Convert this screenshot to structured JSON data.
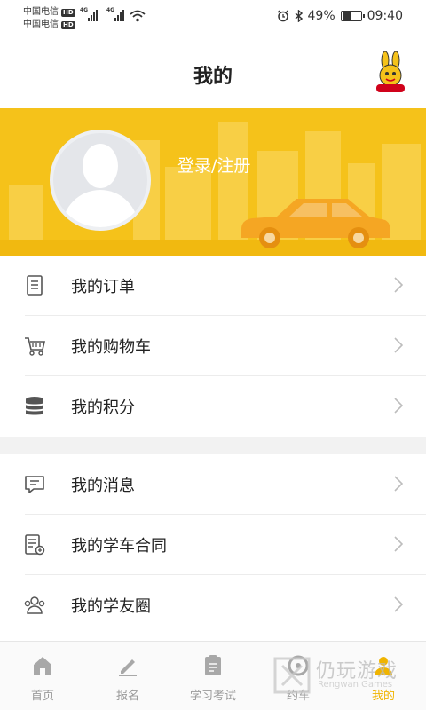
{
  "status_bar": {
    "carrier_1": "中国电信",
    "carrier_2": "中国电信",
    "hd": "HD",
    "network": "4G",
    "battery": "49%",
    "time": "09:40"
  },
  "header": {
    "title": "我的"
  },
  "profile": {
    "login_label": "登录/注册"
  },
  "menu_group_1": [
    {
      "label": "我的订单",
      "icon": "order-icon"
    },
    {
      "label": "我的购物车",
      "icon": "cart-icon"
    },
    {
      "label": "我的积分",
      "icon": "points-icon"
    }
  ],
  "menu_group_2": [
    {
      "label": "我的消息",
      "icon": "message-icon"
    },
    {
      "label": "我的学车合同",
      "icon": "contract-icon"
    },
    {
      "label": "我的学友圈",
      "icon": "friends-icon"
    }
  ],
  "tabbar": [
    {
      "label": "首页",
      "icon": "home-icon"
    },
    {
      "label": "报名",
      "icon": "signup-icon"
    },
    {
      "label": "学习考试",
      "icon": "study-icon"
    },
    {
      "label": "约车",
      "icon": "booking-icon"
    },
    {
      "label": "我的",
      "icon": "profile-icon",
      "active": true
    }
  ],
  "watermark": {
    "text": "仍玩游戏",
    "sub": "Rengwan Games"
  },
  "colors": {
    "accent": "#f0b400",
    "banner": "#f5c21a",
    "car": "#f5a623"
  }
}
